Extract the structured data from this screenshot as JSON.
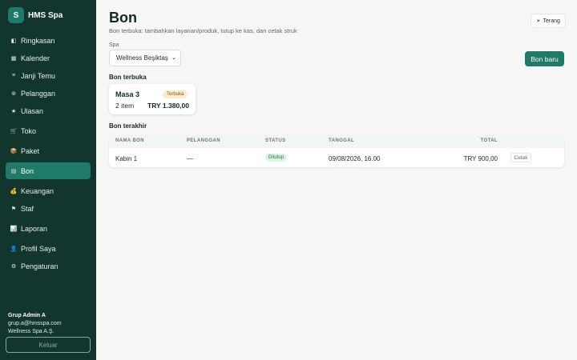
{
  "app": {
    "logo_letter": "S",
    "name": "HMS Spa"
  },
  "sidebar": {
    "items": [
      {
        "label": "Ringkasan",
        "icon": "◧"
      },
      {
        "label": "Kalender",
        "icon": "▦"
      },
      {
        "label": "Janji Temu",
        "icon": "≡"
      },
      {
        "label": "Pelanggan",
        "icon": "⊚"
      },
      {
        "label": "Ulasan",
        "icon": "★"
      },
      {
        "label": "Toko",
        "icon": "🛒"
      },
      {
        "label": "Paket",
        "icon": "📦"
      },
      {
        "label": "Bon",
        "icon": "▤"
      },
      {
        "label": "Keuangan",
        "icon": "💰"
      },
      {
        "label": "Staf",
        "icon": "⚑"
      },
      {
        "label": "Laporan",
        "icon": "📊"
      },
      {
        "label": "Profil Saya",
        "icon": "👤"
      },
      {
        "label": "Pengaturan",
        "icon": "⚙"
      }
    ],
    "active_index": 7,
    "user": {
      "name": "Grup Admin A",
      "email": "grup.a@hmsspa.com",
      "company": "Wellness Spa A.Ş."
    },
    "logout_label": "Keluar"
  },
  "header": {
    "title": "Bon",
    "subtitle": "Bon terbuka: tambahkan layanan/produk, tutup ke kas, dan cetak struk",
    "theme_label": "Terang",
    "theme_icon": "☀"
  },
  "spa_select": {
    "label": "Spa",
    "value": "Wellness Beşiktaş"
  },
  "new_bon_label": "Bon baru",
  "open_section": {
    "title": "Bon terbuka",
    "cards": [
      {
        "name": "Masa 3",
        "badge": "Terbuka",
        "items": "2 item",
        "total": "TRY 1.380,00"
      }
    ]
  },
  "recent_section": {
    "title": "Bon terakhir",
    "columns": [
      "NAMA BON",
      "PELANGGAN",
      "STATUS",
      "TANGGAL",
      "TOTAL"
    ],
    "rows": [
      {
        "name": "Kabin 1",
        "customer": "—",
        "status": "Ditutup",
        "date": "09/08/2026, 16.00",
        "total": "TRY 900,00",
        "action": "Cetak"
      }
    ]
  },
  "colors": {
    "sidebar_bg": "#12362d",
    "accent": "#1f7a68",
    "open_badge_bg": "#fbecd0",
    "closed_badge_bg": "#d9f2e1"
  }
}
